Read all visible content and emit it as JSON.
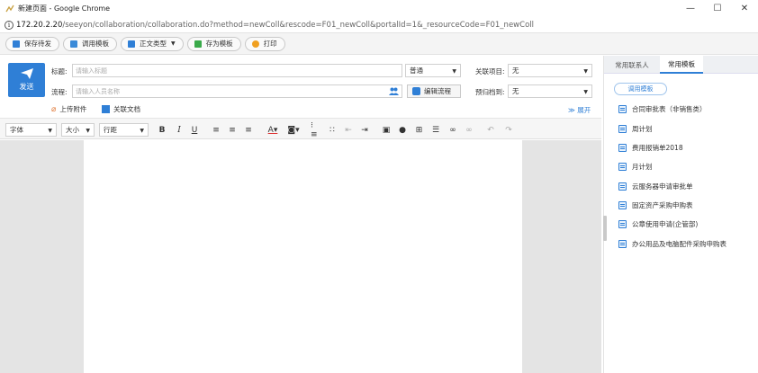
{
  "window": {
    "title": "新建页面 - Google Chrome",
    "minimize_icon": "minimize-icon",
    "maximize_icon": "maximize-icon",
    "close_icon": "close-icon"
  },
  "address": {
    "host": "172.20.2.20",
    "path": "/seeyon/collaboration/collaboration.do?method=newColl&rescode=F01_newColl&portalId=1&_resourceCode=F01_newColl"
  },
  "toolbar": {
    "save_draft": "保存待发",
    "call_template": "调用模板",
    "body_type": "正文类型",
    "save_template": "存为模板",
    "print": "打印"
  },
  "form": {
    "send_label": "发送",
    "subject_label": "标题:",
    "subject_placeholder": "请输入标题",
    "priority_value": "普通",
    "related_project_label": "关联项目:",
    "related_project_value": "无",
    "flow_label": "流程:",
    "flow_placeholder": "请输入人员名称",
    "edit_flow_label": "编辑流程",
    "archive_label": "预归档到:",
    "archive_value": "无",
    "upload_attachment": "上传附件",
    "related_doc": "关联文档",
    "expand": "展开"
  },
  "editor_toolbar": {
    "font_family": "字体",
    "font_size": "大小",
    "line_spacing": "行距"
  },
  "right_panel": {
    "tabs": [
      "常用联系人",
      "常用模板"
    ],
    "active_tab": "常用模板",
    "call_template_button": "调用模板",
    "templates": [
      "合同审批表（非销售类）",
      "周计划",
      "费用报销单2018",
      "月计划",
      "云服务器申请审批单",
      "固定资产采购申购表",
      "公章使用申请(企管部)",
      "办公用品及电脑配件采购申购表"
    ]
  },
  "colors": {
    "accent": "#2f7fd6",
    "toolbar_bg": "#f4f4f4",
    "editor_bg": "#e4e4e4"
  }
}
